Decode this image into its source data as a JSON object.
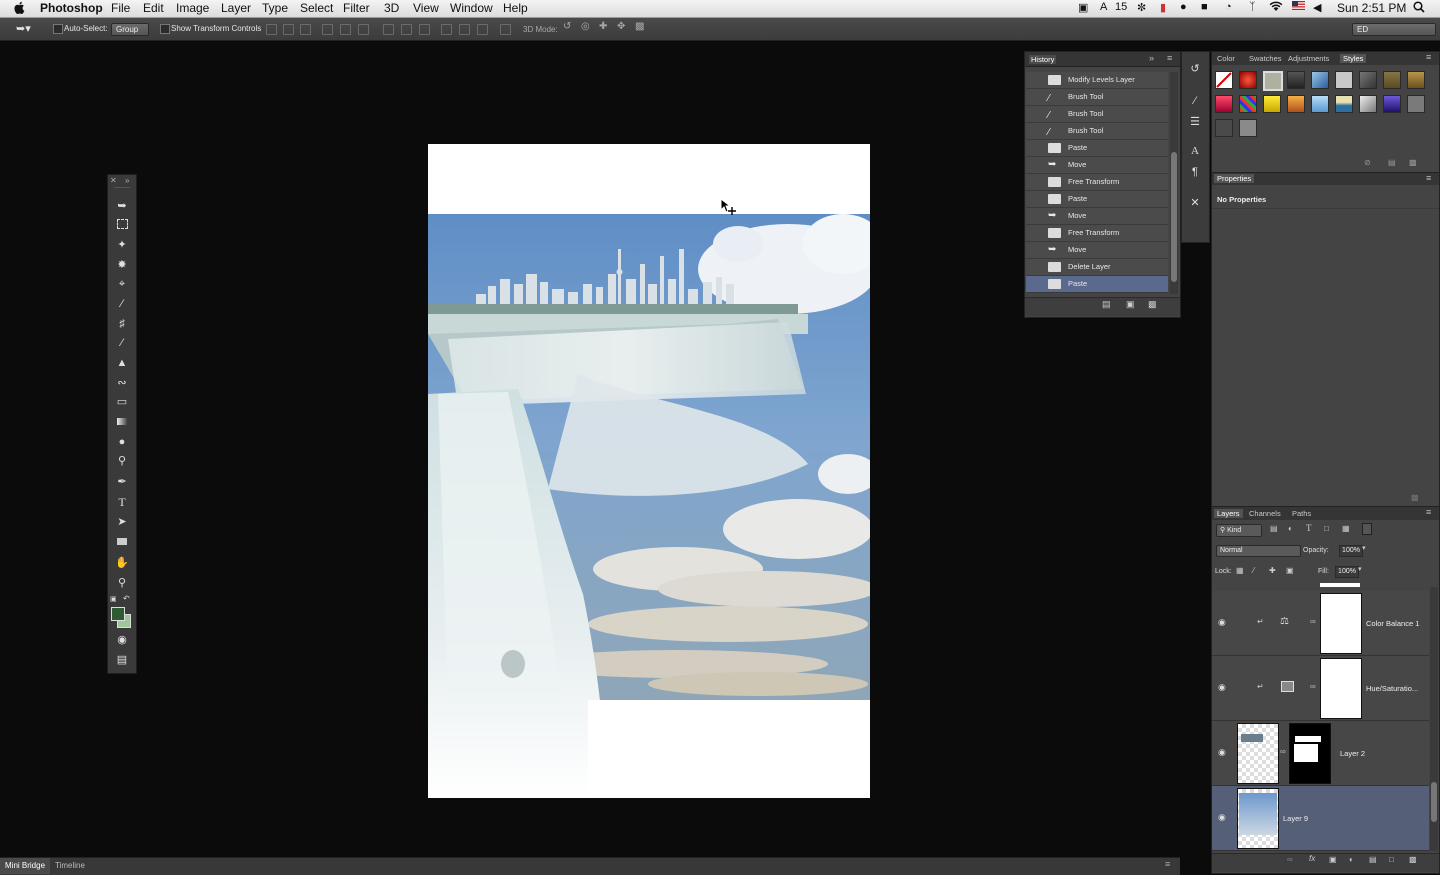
{
  "menubar": {
    "app_name": "Photoshop",
    "menus": [
      "File",
      "Edit",
      "Image",
      "Layer",
      "Type",
      "Select",
      "Filter",
      "3D",
      "View",
      "Window",
      "Help"
    ],
    "status_count": "15",
    "clock": "Sun 2:51 PM"
  },
  "options": {
    "auto_select_label": "Auto-Select:",
    "auto_select_value": "Group",
    "transform_label": "Show Transform Controls",
    "mode3d_label": "3D Mode:",
    "workspace_value": "ED"
  },
  "history": {
    "title": "History",
    "items": [
      {
        "label": "Modify Levels Layer",
        "icon": "document-icon"
      },
      {
        "label": "Brush Tool",
        "icon": "brush-icon"
      },
      {
        "label": "Brush Tool",
        "icon": "brush-icon"
      },
      {
        "label": "Brush Tool",
        "icon": "brush-icon"
      },
      {
        "label": "Paste",
        "icon": "document-icon"
      },
      {
        "label": "Move",
        "icon": "move-icon"
      },
      {
        "label": "Free Transform",
        "icon": "document-icon"
      },
      {
        "label": "Paste",
        "icon": "document-icon"
      },
      {
        "label": "Move",
        "icon": "move-icon"
      },
      {
        "label": "Free Transform",
        "icon": "document-icon"
      },
      {
        "label": "Move",
        "icon": "move-icon"
      },
      {
        "label": "Delete Layer",
        "icon": "document-icon"
      },
      {
        "label": "Paste",
        "icon": "document-icon"
      }
    ]
  },
  "styles_panel": {
    "tabs": [
      "Color",
      "Swatches",
      "Adjustments",
      "Styles"
    ],
    "active_tab": "Styles"
  },
  "properties": {
    "title": "Properties",
    "empty_text": "No Properties"
  },
  "layers": {
    "tabs": [
      "Layers",
      "Channels",
      "Paths"
    ],
    "kind_label": "Kind",
    "blend_mode": "Normal",
    "opacity_label": "Opacity:",
    "opacity_value": "100%",
    "lock_label": "Lock:",
    "fill_label": "Fill:",
    "fill_value": "100%",
    "items": [
      {
        "name": "Color Balance 1"
      },
      {
        "name": "Hue/Saturatio..."
      },
      {
        "name": "Layer 2"
      },
      {
        "name": "Layer 9"
      }
    ]
  },
  "bottom_tabs": [
    "Mini Bridge",
    "Timeline"
  ],
  "colors": {
    "foreground": "#2f5a34",
    "background": "#9fc79a",
    "selection": "#5a6a8e"
  }
}
